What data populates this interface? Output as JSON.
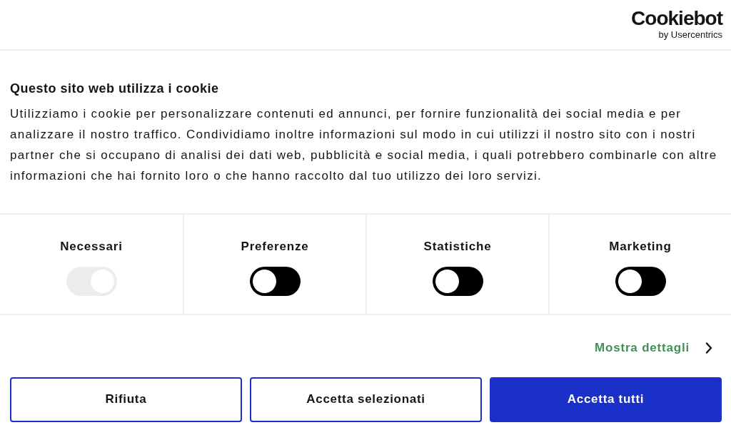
{
  "header": {
    "logo": {
      "name": "Cookiebot",
      "byline": "by Usercentrics"
    }
  },
  "title": "Questo sito web utilizza i cookie",
  "description": "Utilizziamo i cookie per personalizzare contenuti ed annunci, per fornire funzionalità dei social media e per analizzare il nostro traffico. Condividiamo inoltre informazioni sul modo in cui utilizzi il nostro sito con i nostri partner che si occupano di analisi dei dati web, pubblicità e social media, i quali potrebbero combinarle con altre informazioni che hai fornito loro o che hanno raccolto dal tuo utilizzo dei loro servizi.",
  "categories": [
    {
      "label": "Necessari",
      "checked": true,
      "disabled": true
    },
    {
      "label": "Preferenze",
      "checked": false,
      "disabled": false
    },
    {
      "label": "Statistiche",
      "checked": false,
      "disabled": false
    },
    {
      "label": "Marketing",
      "checked": false,
      "disabled": false
    }
  ],
  "details_link": "Mostra dettagli",
  "buttons": [
    {
      "label": "Rifiuta",
      "kind": "outline"
    },
    {
      "label": "Accetta selezionati",
      "kind": "outline"
    },
    {
      "label": "Accetta tutti",
      "kind": "filled"
    }
  ]
}
